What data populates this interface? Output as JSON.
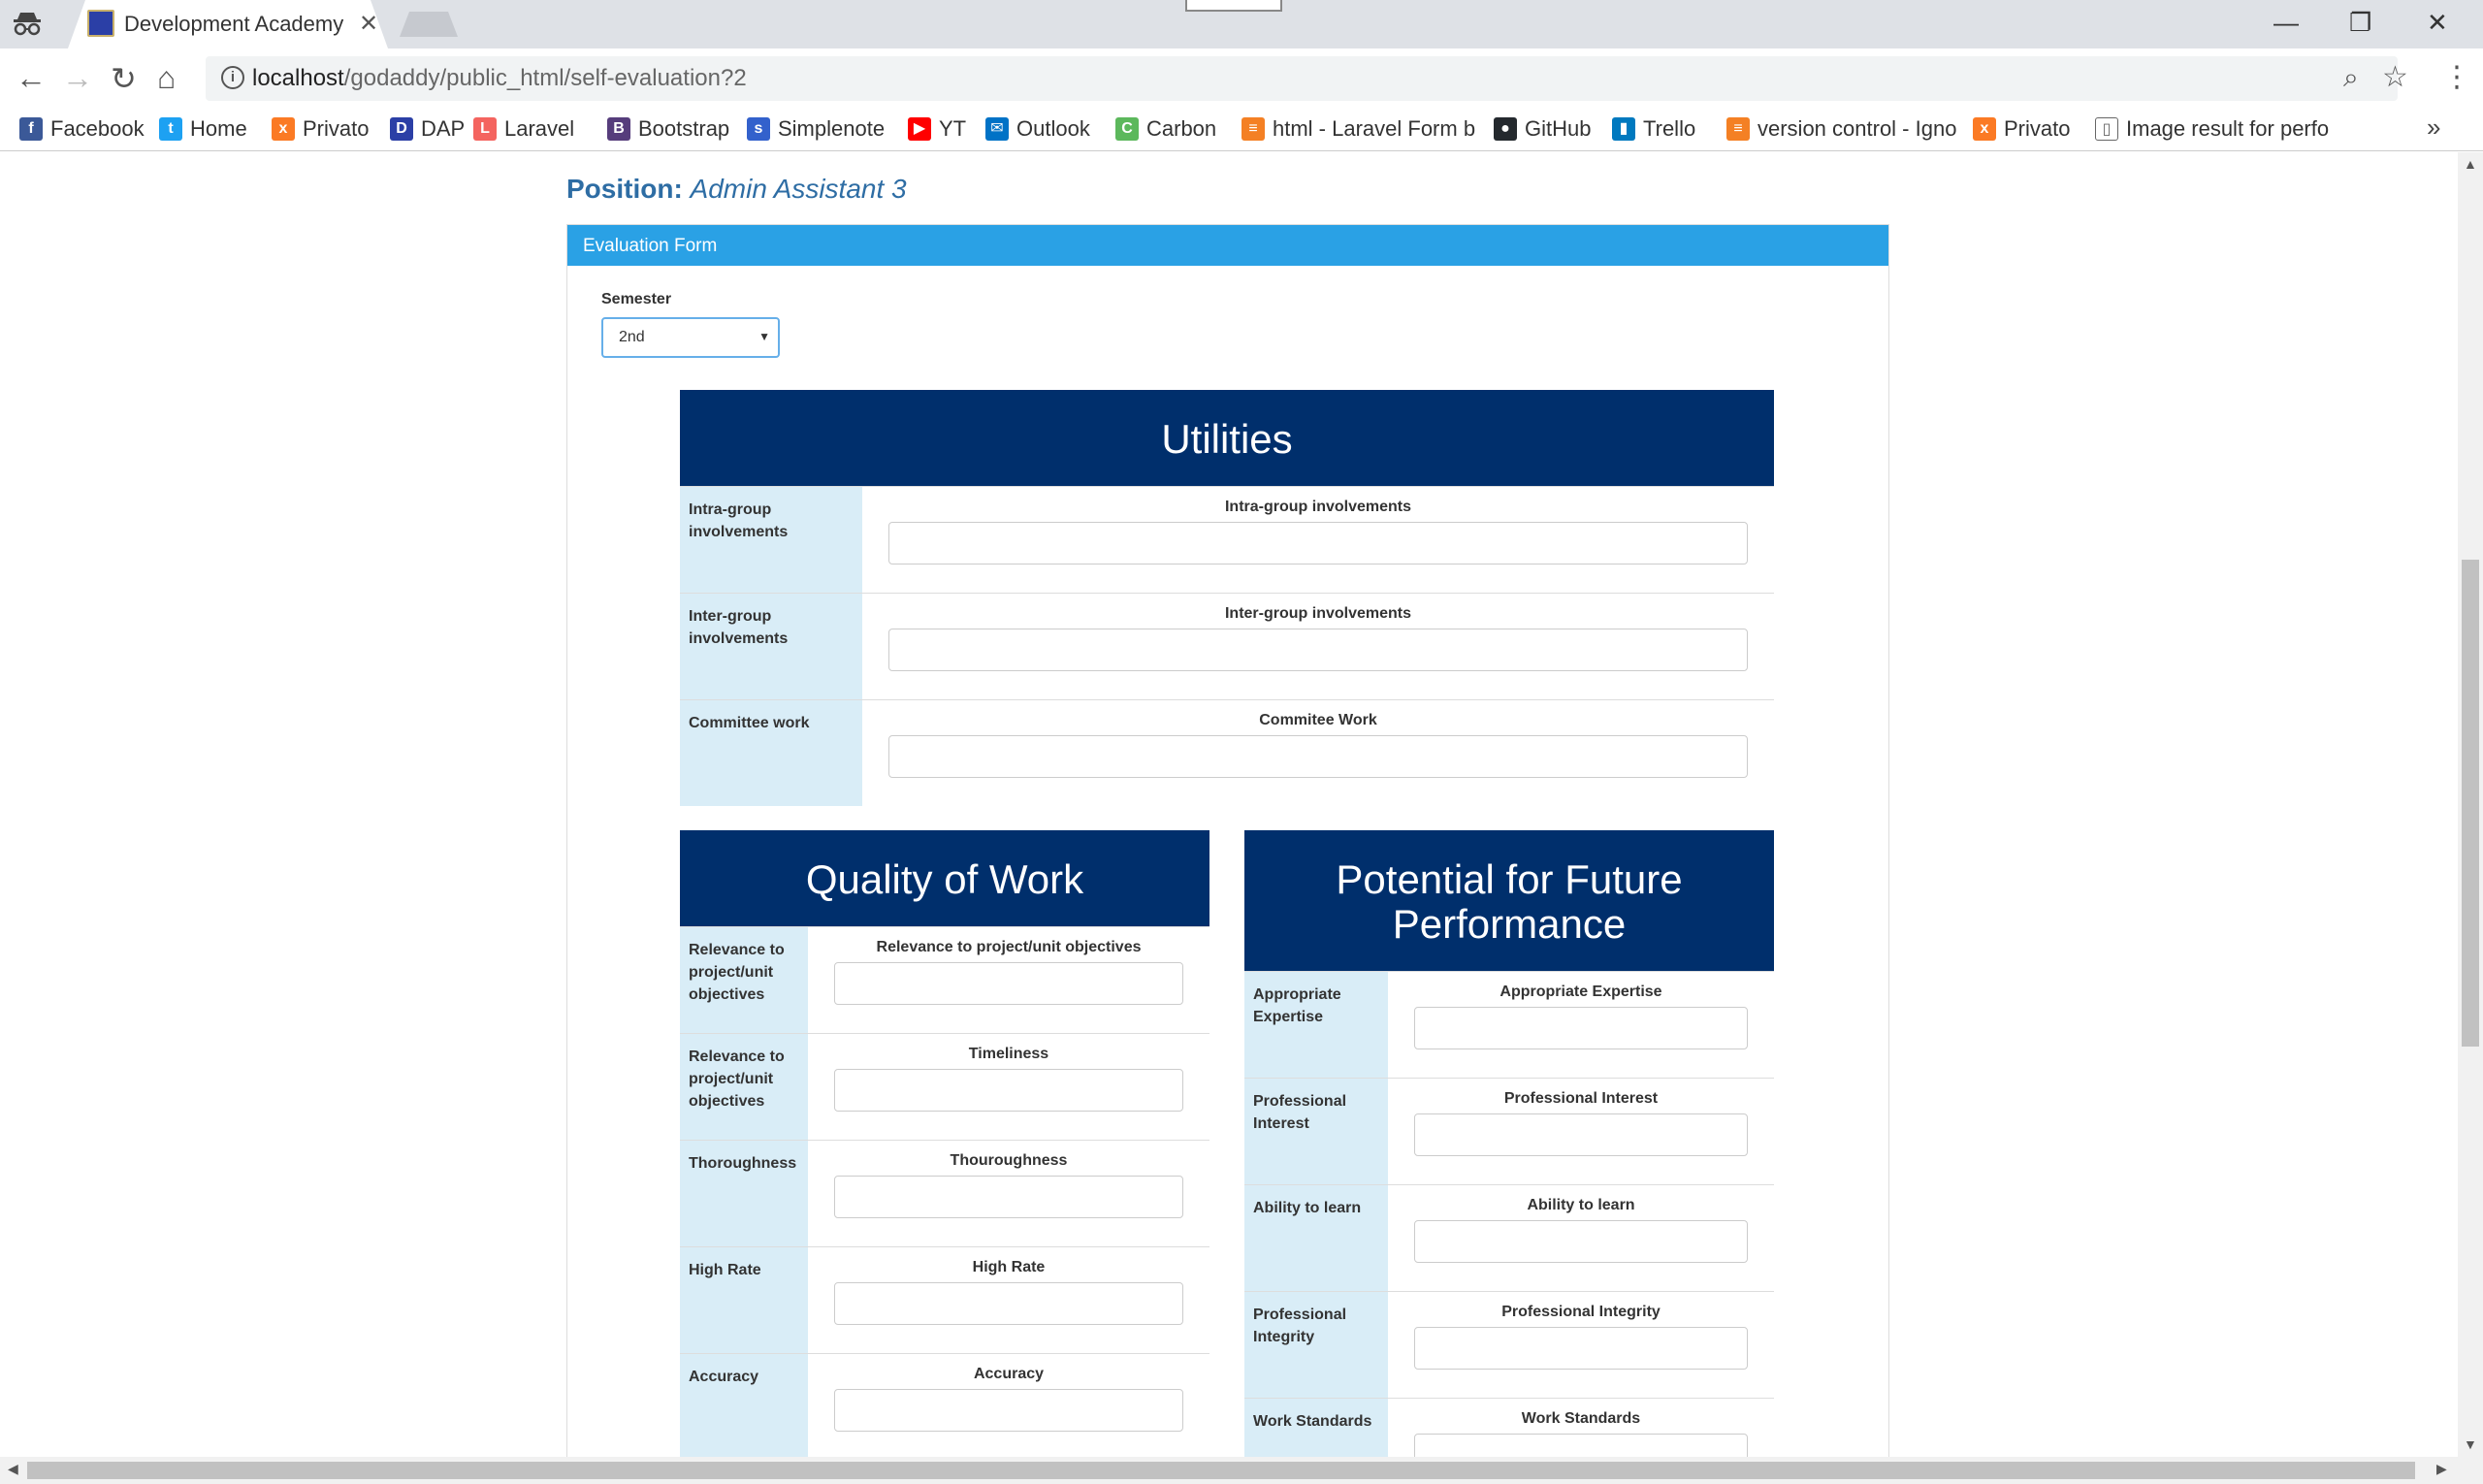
{
  "browser": {
    "tab_title": "Development Academy o",
    "url_host": "localhost",
    "url_path": "/godaddy/public_html/self-evaluation?2",
    "bookmarks": [
      {
        "label": "Facebook",
        "icon": "facebook-icon",
        "color": "#3b5998",
        "glyph": "f"
      },
      {
        "label": "Home",
        "icon": "twitter-icon",
        "color": "#1da1f2",
        "glyph": "t"
      },
      {
        "label": "Privato",
        "icon": "xampp-icon",
        "color": "#fb7a24",
        "glyph": "x"
      },
      {
        "label": "DAP",
        "icon": "dap-icon",
        "color": "#2b3fa6",
        "glyph": "D"
      },
      {
        "label": "Laravel",
        "icon": "laravel-icon",
        "color": "#f4645f",
        "glyph": "L"
      },
      {
        "label": "Bootstrap",
        "icon": "bootstrap-icon",
        "color": "#563d7c",
        "glyph": "B"
      },
      {
        "label": "Simplenote",
        "icon": "simplenote-icon",
        "color": "#3361cc",
        "glyph": "s"
      },
      {
        "label": "YT",
        "icon": "youtube-icon",
        "color": "#ff0000",
        "glyph": "▶"
      },
      {
        "label": "Outlook",
        "icon": "outlook-icon",
        "color": "#0072c6",
        "glyph": "✉"
      },
      {
        "label": "Carbon",
        "icon": "carbon-icon",
        "color": "#5cb85c",
        "glyph": "C"
      },
      {
        "label": "html - Laravel Form b",
        "icon": "stackoverflow-icon",
        "color": "#f48024",
        "glyph": "≡"
      },
      {
        "label": "GitHub",
        "icon": "github-icon",
        "color": "#24292e",
        "glyph": "●"
      },
      {
        "label": "Trello",
        "icon": "trello-icon",
        "color": "#0079bf",
        "glyph": "▮"
      },
      {
        "label": "version control - Igno",
        "icon": "stackoverflow-icon",
        "color": "#f48024",
        "glyph": "≡"
      },
      {
        "label": "Privato",
        "icon": "xampp-icon",
        "color": "#fb7a24",
        "glyph": "x"
      },
      {
        "label": "Image result for perfo",
        "icon": "page-icon",
        "color": "#ffffff",
        "glyph": "▯"
      }
    ]
  },
  "page": {
    "position_label": "Position:",
    "position_value": "Admin Assistant 3",
    "panel_title": "Evaluation Form",
    "semester_label": "Semester",
    "semester_value": "2nd"
  },
  "sections": {
    "utilities": {
      "title": "Utilities",
      "rows": [
        {
          "label": "Intra-group involvements",
          "field": "Intra-group involvements"
        },
        {
          "label": "Inter-group involvements",
          "field": "Inter-group involvements"
        },
        {
          "label": "Committee work",
          "field": "Commitee Work"
        }
      ]
    },
    "quality": {
      "title": "Quality of Work",
      "rows": [
        {
          "label": "Relevance to project/unit objectives",
          "field": "Relevance to project/unit objectives"
        },
        {
          "label": "Relevance to project/unit objectives",
          "field": "Timeliness"
        },
        {
          "label": "Thoroughness",
          "field": "Thouroughness"
        },
        {
          "label": "High Rate",
          "field": "High Rate"
        },
        {
          "label": "Accuracy",
          "field": "Accuracy"
        }
      ]
    },
    "potential": {
      "title": "Potential for Future Performance",
      "rows": [
        {
          "label": "Appropriate Expertise",
          "field": "Appropriate Expertise"
        },
        {
          "label": "Professional Interest",
          "field": "Professional Interest"
        },
        {
          "label": "Ability to learn",
          "field": "Ability to learn"
        },
        {
          "label": "Professional Integrity",
          "field": "Professional Integrity"
        },
        {
          "label": "Work Standards",
          "field": "Work Standards"
        }
      ]
    }
  }
}
